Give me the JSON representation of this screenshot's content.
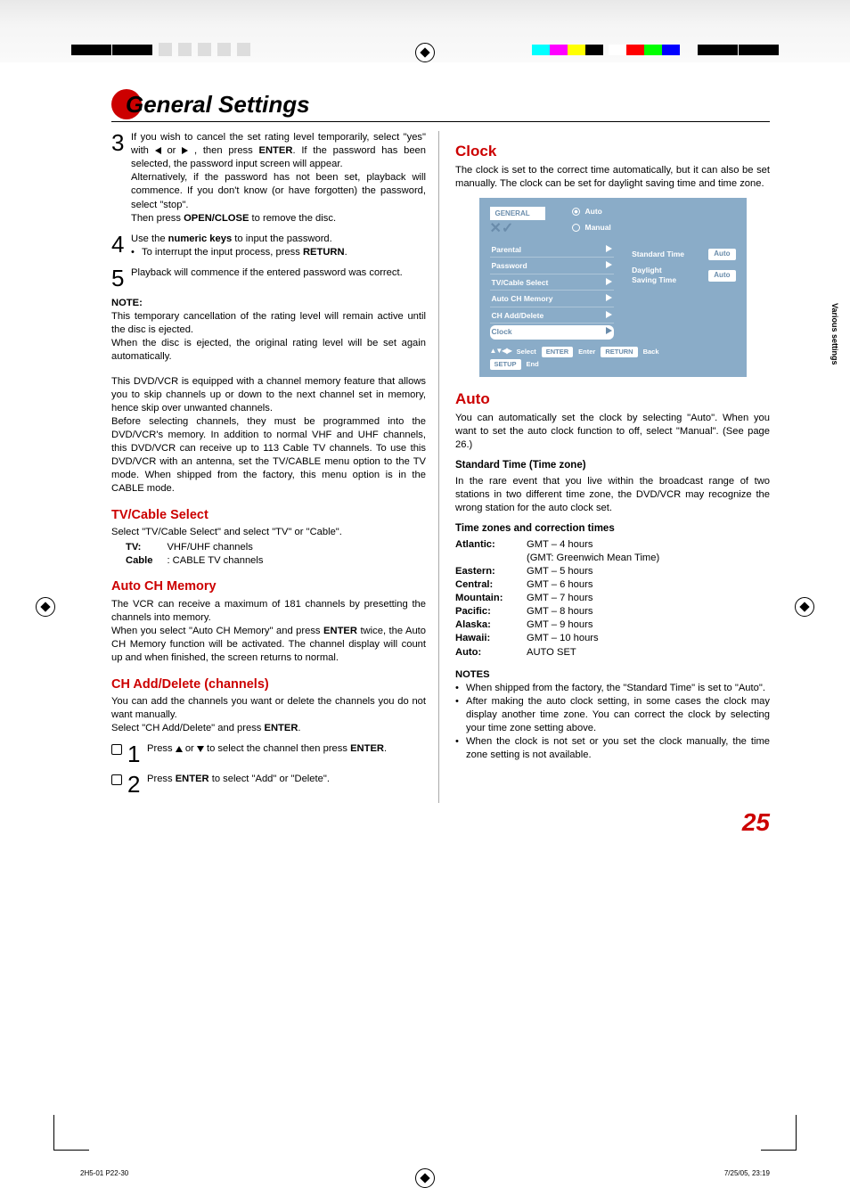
{
  "header": {
    "title": "General Settings"
  },
  "sideTab": "Various settings",
  "leftCol": {
    "step3": {
      "p1a": "If you wish to cancel the set rating level temporarily, select \"yes\" with ",
      "p1b": " or ",
      "p1c": " , then press ",
      "enter": "ENTER",
      "p1d": ". If the password has been selected, the password input screen will appear.",
      "p2": "Alternatively, if the password has not been set, playback will commence. If you don't know (or have forgotten) the password, select \"stop\".",
      "p3a": "Then press ",
      "p3b": "OPEN/CLOSE",
      "p3c": " to remove the disc."
    },
    "step4": {
      "l1a": "Use the ",
      "l1b": "numeric keys",
      "l1c": " to input the password.",
      "l2a": "To interrupt the input process, press ",
      "l2b": "RETURN",
      "l2c": "."
    },
    "step5": "Playback will commence if the entered password was correct.",
    "noteH": "NOTE:",
    "noteP1": "This temporary cancellation of the rating level will remain active until the disc is ejected.",
    "noteP2": "When the disc is ejected, the original rating level will be set again automatically.",
    "chanP1": "This DVD/VCR is equipped with a channel memory feature that allows you to skip channels up or down to the next channel set in memory, hence skip over unwanted channels.",
    "chanP2": "Before selecting channels, they must be programmed into the DVD/VCR's memory. In addition to normal VHF and UHF channels, this DVD/VCR can receive up to 113 Cable TV channels. To use this DVD/VCR with an antenna, set the TV/CABLE menu option to the TV mode. When shipped from the factory, this menu option is in the CABLE mode.",
    "tvcable": {
      "h": "TV/Cable Select",
      "p": "Select \"TV/Cable Select\" and select \"TV\" or \"Cable\".",
      "tv_k": "TV:",
      "tv_v": "VHF/UHF channels",
      "cable_k": "Cable",
      "cable_v": ": CABLE TV channels"
    },
    "autoch": {
      "h": "Auto CH Memory",
      "p1": "The VCR can receive a maximum of 181 channels by presetting the channels into memory.",
      "p2a": "When you select \"Auto CH Memory\" and press ",
      "p2b": "ENTER",
      "p2c": " twice, the Auto CH Memory function will be activated. The channel display will count up and when finished, the screen returns to normal."
    },
    "chadd": {
      "h": "CH Add/Delete (channels)",
      "p1": "You can add the channels you want or delete the channels you do not want manually.",
      "p2a": "Select \"CH Add/Delete\" and press ",
      "p2b": "ENTER",
      "p2c": ".",
      "s1a": "Press ",
      "s1b": " or ",
      "s1c": " to select the channel then press ",
      "s1d": "ENTER",
      "s1e": ".",
      "s2a": "Press ",
      "s2b": "ENTER",
      "s2c": " to select \"Add\" or \"Delete\"."
    }
  },
  "rightCol": {
    "clock": {
      "h": "Clock",
      "p": "The clock is set to the correct time automatically, but it can also be set manually. The clock can be set for daylight saving time and time zone."
    },
    "osd": {
      "tab": "GENERAL",
      "radio1": "Auto",
      "radio2": "Manual",
      "menu": [
        "Parental",
        "Password",
        "TV/Cable Select",
        "Auto CH Memory",
        "CH Add/Delete",
        "Clock"
      ],
      "right1_lbl": "Standard Time",
      "right1_val": "Auto",
      "right2_lbl1": "Daylight",
      "right2_lbl2": "Saving Time",
      "right2_val": "Auto",
      "bot_select": "Select",
      "bot_enter": "ENTER",
      "bot_enterlbl": "Enter",
      "bot_return": "RETURN",
      "bot_back": "Back",
      "bot_setup": "SETUP",
      "bot_end": "End"
    },
    "auto": {
      "h": "Auto",
      "p": "You can automatically set the clock by selecting \"Auto\". When you want to set the auto clock function to off, select \"Manual\". (See page 26.)"
    },
    "std": {
      "h": "Standard Time (Time zone)",
      "p": "In the rare event that you live within the broadcast range of two stations in two different time zone, the DVD/VCR may recognize the wrong station for the auto clock set."
    },
    "tz": {
      "h": "Time zones and correction times",
      "rows": [
        {
          "k": "Atlantic",
          "v": "GMT – 4 hours",
          "v2": "(GMT: Greenwich Mean Time)"
        },
        {
          "k": "Eastern",
          "v": "GMT – 5 hours"
        },
        {
          "k": "Central",
          "v": "GMT – 6 hours"
        },
        {
          "k": "Mountain",
          "v": "GMT – 7 hours"
        },
        {
          "k": "Pacific",
          "v": "GMT – 8 hours"
        },
        {
          "k": "Alaska",
          "v": "GMT – 9 hours"
        },
        {
          "k": "Hawaii",
          "v": "GMT – 10 hours"
        },
        {
          "k": "Auto",
          "v": "AUTO SET"
        }
      ]
    },
    "notes": {
      "h": "NOTES",
      "n1": "When shipped from the factory, the \"Standard Time\" is set to \"Auto\".",
      "n2": "After making the auto clock setting, in some cases the clock may display another time zone. You can correct the clock by selecting your time zone setting above.",
      "n3": "When the clock is not set or you set the clock manually, the time zone setting is not available."
    }
  },
  "pageNum": "25",
  "footer": {
    "file": "2H5-01 P22-30",
    "pg": "25",
    "ts": "7/25/05, 23:19"
  }
}
